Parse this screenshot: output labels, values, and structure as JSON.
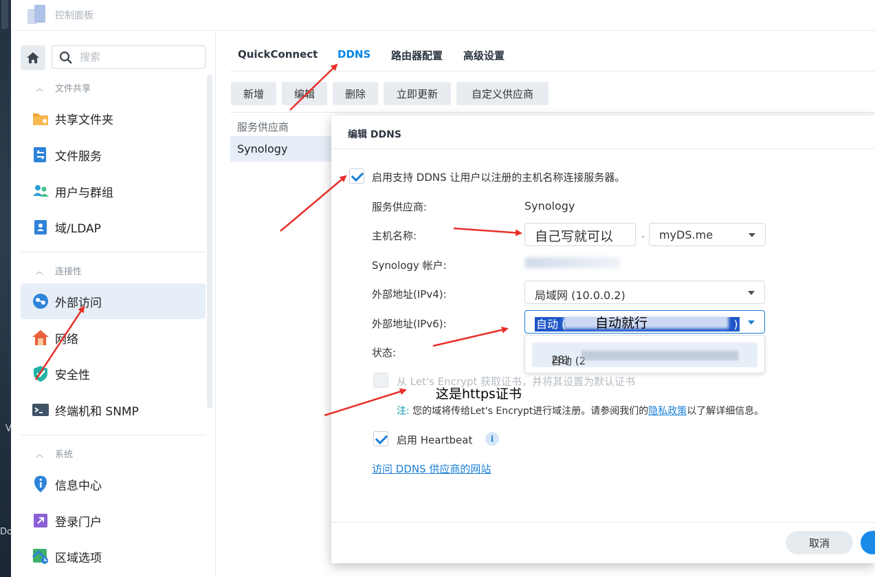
{
  "window": {
    "title": "控制面板"
  },
  "sidebar": {
    "search_placeholder": "搜索",
    "sections": [
      {
        "label": "文件共享",
        "items": [
          "共享文件夹",
          "文件服务",
          "用户与群组",
          "域/LDAP"
        ]
      },
      {
        "label": "连接性",
        "items": [
          "外部访问",
          "网络",
          "安全性",
          "终端机和 SNMP"
        ]
      },
      {
        "label": "系统",
        "items": [
          "信息中心",
          "登录门户",
          "区域选项"
        ]
      }
    ],
    "active_item": "外部访问"
  },
  "tabs": [
    {
      "label": "QuickConnect",
      "active": false
    },
    {
      "label": "DDNS",
      "active": true
    },
    {
      "label": "路由器配置",
      "active": false
    },
    {
      "label": "高级设置",
      "active": false
    }
  ],
  "toolbar": {
    "buttons": [
      "新增",
      "编辑",
      "删除",
      "立即更新",
      "自定义供应商"
    ]
  },
  "grid": {
    "header": "服务供应商",
    "rows": [
      "Synology"
    ]
  },
  "dialog": {
    "title": "编辑 DDNS",
    "enable_label": "启用支持 DDNS 让用户以注册的主机名称连接服务器。",
    "enable_checked": true,
    "provider_label": "服务供应商:",
    "provider_value": "Synology",
    "hostname_label": "主机名称:",
    "hostname_value": "自己写就可以",
    "hostname_dot": ".",
    "domain_value": "myDS.me",
    "account_label": "Synology 帐户:",
    "ipv4_label": "外部地址(IPv4):",
    "ipv4_value": "局域网 (10.0.0.2)",
    "ipv6_label": "外部地址(IPv6):",
    "ipv6_value_prefix": "自动 (",
    "ipv6_value_suffix": ")",
    "ipv6_option_prefix": "自动 (2",
    "ipv6_option_suffix": "28)",
    "status_label": "状态:",
    "letsencrypt_label": "从 Let's Encrypt 获取证书，并将其设置为默认证书",
    "note_key": "注:",
    "note_text": "您的域将传给Let's Encrypt进行域注册。请参阅我们的",
    "note_link": "隐私政策",
    "note_tail": "以了解详细信息。",
    "heartbeat_label": "启用 Heartbeat",
    "heartbeat_checked": true,
    "info_glyph": "i",
    "provider_site_link": "访问 DDNS 供应商的网站",
    "cancel_label": "取消"
  },
  "annotations": {
    "ipv6_note": "自动就行",
    "https_note": "这是https证书"
  },
  "desktop_text": {
    "left1": "V",
    "left2": "Do"
  },
  "colors": {
    "accent": "#0086e5",
    "arrow": "#e8302a",
    "selected_bg": "#e6eef7"
  }
}
